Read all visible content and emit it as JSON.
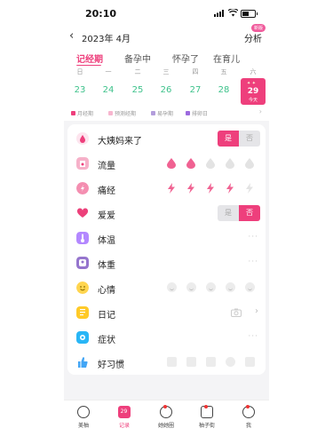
{
  "status": {
    "time": "20:10"
  },
  "nav": {
    "back": "‹",
    "month": "2023年 4月",
    "analysis": "分析",
    "analysis_badge": "新版"
  },
  "tabs": [
    {
      "label": "记经期",
      "active": true
    },
    {
      "label": "备孕中",
      "active": false
    },
    {
      "label": "怀孕了",
      "active": false
    },
    {
      "label": "在育儿",
      "active": false
    }
  ],
  "weekdays": [
    "日",
    "一",
    "二",
    "三",
    "四",
    "五",
    "六"
  ],
  "dates": [
    "23",
    "24",
    "25",
    "26",
    "27",
    "28"
  ],
  "today": {
    "day": "29",
    "label": "今天"
  },
  "legend": [
    {
      "label": "月经期",
      "color": "#ee3f7c"
    },
    {
      "label": "预测经期",
      "color": "#f7b6cf"
    },
    {
      "label": "易孕期",
      "color": "#b39ddb"
    },
    {
      "label": "排卵日",
      "color": "#9c6ade"
    }
  ],
  "rows": {
    "period": {
      "label": "大姨妈来了",
      "yes": "是",
      "no": "否",
      "value": "是"
    },
    "flow": {
      "label": "流量",
      "level": 2,
      "max": 5
    },
    "pain": {
      "label": "痛经",
      "level": 4,
      "max": 5
    },
    "love": {
      "label": "爱爱",
      "yes": "是",
      "no": "否",
      "value": "否"
    },
    "temp": {
      "label": "体温"
    },
    "weight": {
      "label": "体重"
    },
    "mood": {
      "label": "心情"
    },
    "diary": {
      "label": "日记"
    },
    "symptom": {
      "label": "症状"
    },
    "habit": {
      "label": "好习惯"
    }
  },
  "tabbar": [
    {
      "label": "美柚",
      "active": false
    },
    {
      "label": "记录",
      "active": true,
      "badge": "29"
    },
    {
      "label": "她她圈",
      "active": false
    },
    {
      "label": "柚子街",
      "active": false
    },
    {
      "label": "我",
      "active": false
    }
  ],
  "colors": {
    "accent": "#ee3f7c",
    "green_date": "#3ec28b"
  }
}
